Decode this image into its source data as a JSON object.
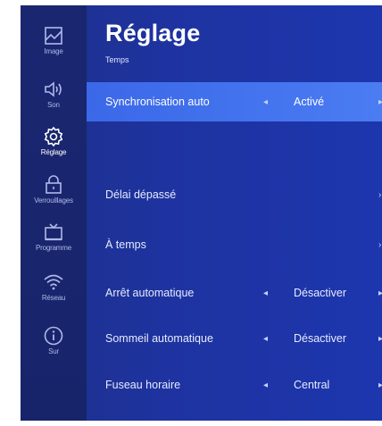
{
  "sidebar": {
    "items": [
      {
        "label": "Image",
        "icon": "picture-icon"
      },
      {
        "label": "Son",
        "icon": "speaker-icon"
      },
      {
        "label": "Réglage",
        "icon": "gear-icon",
        "active": true
      },
      {
        "label": "Verrouillages",
        "icon": "lock-icon"
      },
      {
        "label": "Programme",
        "icon": "tv-icon"
      },
      {
        "label": "Réseau",
        "icon": "wifi-icon"
      },
      {
        "label": "Sur",
        "icon": "info-icon"
      }
    ]
  },
  "header": {
    "title": "Réglage",
    "subtitle": "Temps"
  },
  "settings": [
    {
      "label": "Synchronisation auto",
      "value": "Activé",
      "selected": true
    },
    {
      "label": "",
      "value": "",
      "disabled": true
    },
    {
      "label": "Délai dépassé",
      "value": ""
    },
    {
      "label": "À temps",
      "value": ""
    },
    {
      "label": "Arrêt automatique",
      "value": "Désactiver"
    },
    {
      "label": "Sommeil automatique",
      "value": "Désactiver"
    },
    {
      "label": "Fuseau horaire",
      "value": "Central"
    }
  ],
  "colors": {
    "background": "#1e33a0",
    "sidebar": "#1a2670",
    "highlight": "#4273ee"
  }
}
